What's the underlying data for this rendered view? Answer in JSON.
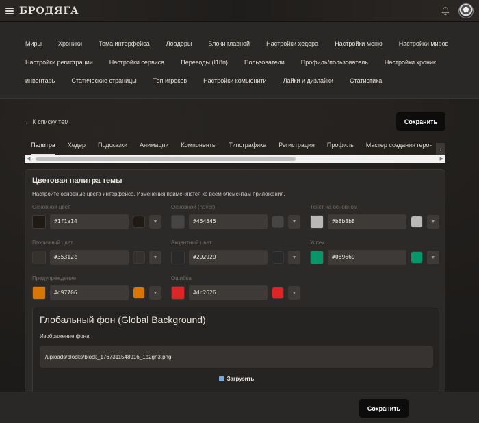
{
  "app": {
    "logo": "БРОДЯГА"
  },
  "nav": {
    "rows": [
      [
        "Миры",
        "Хроники",
        "Тема интерфейса",
        "Лоадеры",
        "Блоки главной",
        "Настройки хедера",
        "Настройки меню",
        "Настройки миров"
      ],
      [
        "Настройки регистрации",
        "Настройки сервиса",
        "Переводы (I18n)",
        "Пользователи",
        "Профиль/пользователь",
        "Настройки хроник"
      ],
      [
        "инвентарь",
        "Статические страницы",
        "Топ игроков",
        "Настройки комьюнити",
        "Лайки и дизлайки",
        "Статистика"
      ]
    ]
  },
  "page": {
    "back_link": "← К списку тем",
    "save_label": "Сохранить",
    "tabs": [
      "Палитра",
      "Хедер",
      "Подсказки",
      "Анимации",
      "Компоненты",
      "Типографика",
      "Регистрация",
      "Профиль",
      "Мастер создания героя"
    ],
    "active_tab": "Палитра",
    "tab_scroll_icon": "›"
  },
  "palette": {
    "title": "Цветовая палитра темы",
    "description": "Настройте основные цвета интерфейса. Изменения применяются ко всем элементам приложения.",
    "fields": [
      {
        "label": "Основной цвет",
        "hex": "#1f1a14"
      },
      {
        "label": "Основной (hover)",
        "hex": "#454545"
      },
      {
        "label": "Текст на основном",
        "hex": "#b8b8b8"
      },
      {
        "label": "Вторичный цвет",
        "hex": "#35312c"
      },
      {
        "label": "Акцентный цвет",
        "hex": "#292929"
      },
      {
        "label": "Успех",
        "hex": "#059669"
      },
      {
        "label": "Предупреждение",
        "hex": "#d97706"
      },
      {
        "label": "Ошибка",
        "hex": "#dc2626"
      }
    ],
    "dropdown_icon": "▼"
  },
  "global_bg": {
    "title": "Глобальный фон (Global Background)",
    "image_label": "Изображение фона",
    "image_path": "/uploads/blocks/block_1767311548916_1p2gn3.png",
    "upload_label": "Загрузить"
  },
  "footer": {
    "save_label": "Сохранить"
  }
}
